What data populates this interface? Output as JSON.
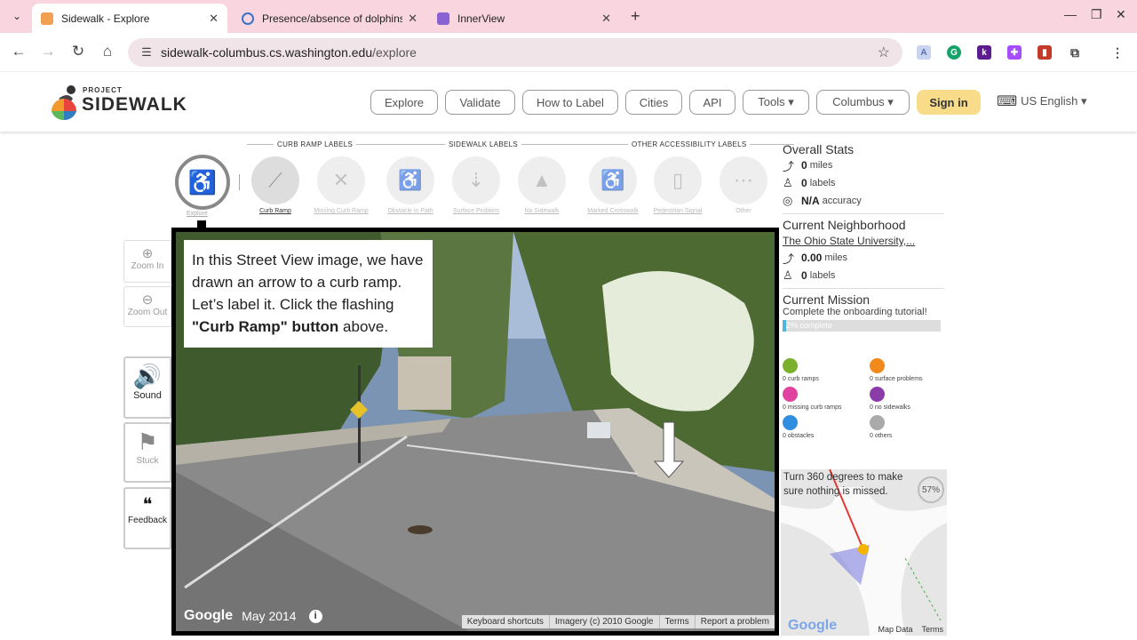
{
  "browser": {
    "tabs": [
      {
        "label": "Sidewalk - Explore",
        "active": true
      },
      {
        "label": "Presence/absence of dolphins",
        "active": false
      },
      {
        "label": "InnerView",
        "active": false
      }
    ],
    "url_host": "sidewalk-columbus.cs.washington.edu",
    "url_path": "/explore",
    "new_tab": "+",
    "close": "✕"
  },
  "site": {
    "logo_small": "PROJECT",
    "logo_big": "SIDEWALK",
    "nav": [
      "Explore",
      "Validate",
      "How to Label",
      "Cities",
      "API",
      "Tools ▾",
      "Columbus ▾"
    ],
    "signin": "Sign in",
    "language": "US English ▾"
  },
  "labels": {
    "sections": [
      "CURB RAMP LABELS",
      "SIDEWALK LABELS",
      "OTHER ACCESSIBILITY LABELS"
    ],
    "explore": "Explore",
    "buttons": [
      {
        "label": "Curb Ramp",
        "icon": "curb-ramp-icon"
      },
      {
        "label": "Missing Curb Ramp",
        "icon": "missing-curb-ramp-icon"
      },
      {
        "label": "Obstacle in Path",
        "icon": "obstacle-icon"
      },
      {
        "label": "Surface Problem",
        "icon": "surface-problem-icon"
      },
      {
        "label": "No Sidewalk",
        "icon": "no-sidewalk-icon"
      },
      {
        "label": "Marked Crosswalk",
        "icon": "crosswalk-icon"
      },
      {
        "label": "Pedestrian Signal",
        "icon": "pedestrian-signal-icon"
      },
      {
        "label": "Other",
        "icon": "more-icon"
      }
    ]
  },
  "tools": {
    "zoom_in": "Zoom In",
    "zoom_out": "Zoom Out",
    "sound": "Sound",
    "stuck": "Stuck",
    "feedback": "Feedback"
  },
  "streetview": {
    "message_plain": "In this Street View image, we have drawn an arrow to a curb ramp. Let’s label it. Click the flashing ",
    "message_bold": "\"Curb Ramp\" button",
    "message_end": " above.",
    "google": "Google",
    "date": "May 2014",
    "footer": [
      "Keyboard shortcuts",
      "Imagery (c) 2010 Google",
      "Terms",
      "Report a problem"
    ]
  },
  "stats": {
    "overall_title": "Overall Stats",
    "miles": "0",
    "miles_unit": "miles",
    "labels": "0",
    "labels_unit": "labels",
    "accuracy": "N/A",
    "accuracy_unit": "accuracy",
    "neighborhood_title": "Current Neighborhood",
    "neighborhood": "The Ohio State University,...",
    "n_miles": "0.00",
    "n_miles_unit": "miles",
    "n_labels": "0",
    "n_labels_unit": "labels",
    "mission_title": "Current Mission",
    "mission_text": "Complete the onboarding tutorial!",
    "mission_progress": "2% complete",
    "mission_progress_value": 0.02
  },
  "legend": [
    {
      "text": "0 curb ramps",
      "color": "#7bb02c"
    },
    {
      "text": "0 surface problems",
      "color": "#f28a1b"
    },
    {
      "text": "0 missing curb ramps",
      "color": "#e042a0"
    },
    {
      "text": "0 no sidewalks",
      "color": "#8a3ca8"
    },
    {
      "text": "0 obstacles",
      "color": "#2e8fe0"
    },
    {
      "text": "0 others",
      "color": "#aaaaaa"
    }
  ],
  "minimap": {
    "text": "Turn 360 degrees to make sure nothing is missed.",
    "percent": "57%",
    "google": "Google",
    "map_data": "Map Data",
    "terms": "Terms"
  }
}
